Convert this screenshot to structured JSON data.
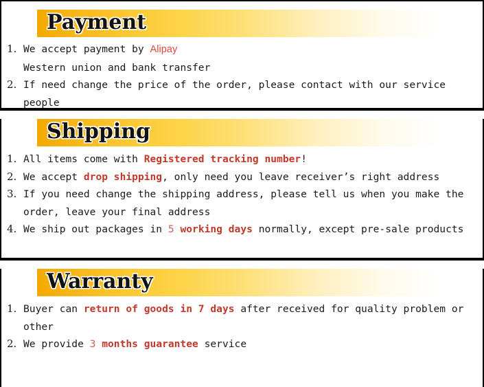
{
  "page": {
    "background": "#ffffff",
    "accent_gradient_start": "#f2a900",
    "accent_gradient_end": "#ffffff",
    "highlight_color": "#c0392b",
    "alipay_color": "#d94a3d",
    "text_color": "#1a1a1a",
    "border_color": "#000000"
  },
  "sections": {
    "payment": {
      "title": "Payment",
      "items": {
        "i1": {
          "a": "We accept payment by ",
          "brand": "Alipay",
          "line2": "Western union and bank transfer"
        },
        "i2": {
          "a": "If need change the price of the order, please contact with our service people"
        }
      }
    },
    "shipping": {
      "title": "Shipping",
      "items": {
        "i1": {
          "a": "All items come with ",
          "hl": "Registered tracking number",
          "b": "!"
        },
        "i2": {
          "a": "We accept ",
          "hl": "drop shipping",
          "b": ", only need you leave receiver’s right address"
        },
        "i3": {
          "a": "If you need change the shipping address, please tell us when you make the order, leave your final address"
        },
        "i4": {
          "a": "We ship out packages in ",
          "num": "5",
          "hl": " working days",
          "b": " normally, except pre-sale products"
        }
      }
    },
    "warranty": {
      "title": "Warranty",
      "items": {
        "i1": {
          "a": "Buyer can ",
          "hl": "return of goods in 7 days",
          "b": " after received for quality problem or other"
        },
        "i2": {
          "a": "We provide ",
          "num": "3",
          "hl": " months guarantee",
          "b": " service"
        }
      }
    }
  }
}
